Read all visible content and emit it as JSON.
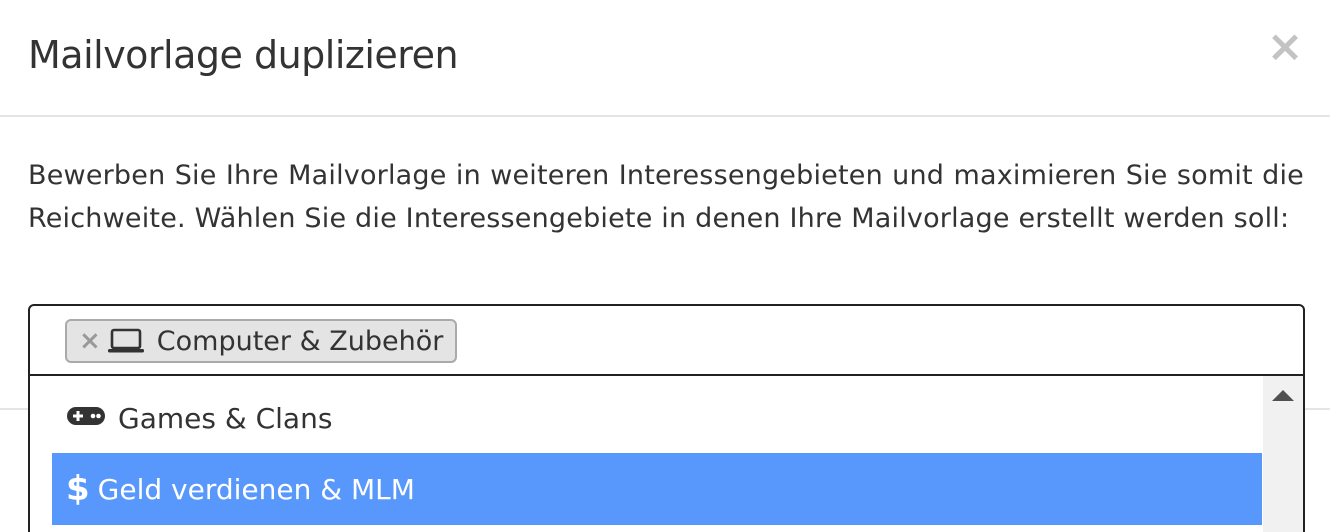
{
  "modal": {
    "title": "Mailvorlage duplizieren",
    "close_glyph": "×",
    "description": "Bewerben Sie Ihre Mailvorlage in weiteren Interessengebieten und maximieren Sie somit die Reichweite. Wählen Sie die Interessengebiete in denen Ihre Mailvorlage erstellt werden soll:"
  },
  "select": {
    "selected_chips": [
      {
        "remove_glyph": "×",
        "icon": "laptop-icon",
        "label": "Computer & Zubehör"
      }
    ],
    "options": [
      {
        "icon": "gamepad-icon",
        "label": "Games & Clans",
        "highlighted": false
      },
      {
        "icon": "dollar-icon",
        "icon_glyph": "$",
        "label": "Geld verdienen & MLM",
        "highlighted": true
      }
    ],
    "highlight_color": "#5897fb"
  }
}
